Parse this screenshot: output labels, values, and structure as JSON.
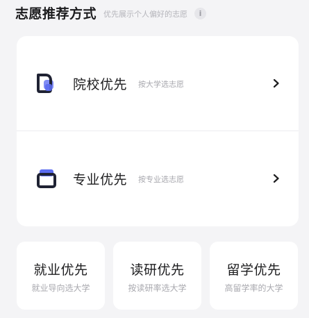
{
  "header": {
    "title": "志愿推荐方式",
    "subtitle": "优先展示个人偏好的志愿",
    "info_glyph": "i"
  },
  "options": [
    {
      "label": "院校优先",
      "description": "按大学选志愿",
      "icon": "school-icon"
    },
    {
      "label": "专业优先",
      "description": "按专业选志愿",
      "icon": "major-icon"
    }
  ],
  "cards": [
    {
      "title": "就业优先",
      "description": "就业导向选大学"
    },
    {
      "title": "读研优先",
      "description": "按读研率选大学"
    },
    {
      "title": "留学优先",
      "description": "高留学率的大学"
    }
  ],
  "colors": {
    "background": "#f4f4f6",
    "card": "#ffffff",
    "icon_dark": "#1f2233",
    "icon_accent": "#5b6cf0"
  }
}
